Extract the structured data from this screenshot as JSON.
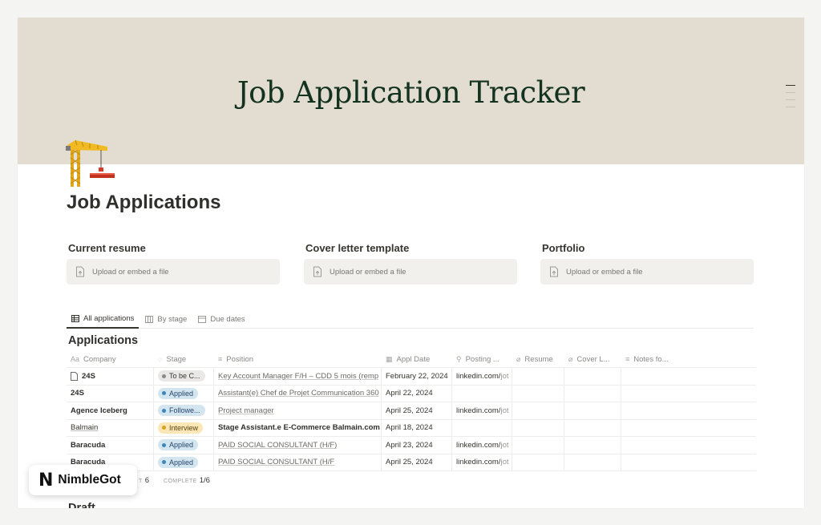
{
  "cover": {
    "title": "Job Application Tracker"
  },
  "page": {
    "title": "Job Applications"
  },
  "files": [
    {
      "label": "Current resume",
      "placeholder": "Upload or embed a file"
    },
    {
      "label": "Cover letter template",
      "placeholder": "Upload or embed a file"
    },
    {
      "label": "Portfolio",
      "placeholder": "Upload or embed a file"
    }
  ],
  "tabs": [
    "All applications",
    "By stage",
    "Due dates"
  ],
  "database": {
    "title": "Applications",
    "columns": [
      "Company",
      "Stage",
      "Position",
      "Appl Date",
      "Posting ...",
      "Resume",
      "Cover L...",
      "Notes fo..."
    ],
    "rows": [
      {
        "company": "24S",
        "stage": "To be C...",
        "position": "Key Account Manager F/H – CDD 5 mois (remp",
        "date": "February 22, 2024",
        "posting_a": "linkedin.com/",
        "posting_b": "jot"
      },
      {
        "company": "24S",
        "stage": "Applied",
        "position": "Assistant(e) Chef de Projet Communication 360",
        "date": "April 22, 2024",
        "posting_a": "",
        "posting_b": ""
      },
      {
        "company": "Agence Iceberg",
        "stage": "Followe...",
        "position": "Project manager",
        "date": "April 25, 2024",
        "posting_a": "linkedin.com/",
        "posting_b": "jot"
      },
      {
        "company": "Balmain",
        "stage": "Interview",
        "position": "Stage Assistant.e E-Commerce Balmain.com",
        "date": "April 18, 2024",
        "posting_a": "",
        "posting_b": ""
      },
      {
        "company": "Baracuda",
        "stage": "Applied",
        "position": "PAID SOCIAL CONSULTANT (H/F)",
        "date": "April 23, 2024",
        "posting_a": "linkedin.com/",
        "posting_b": "jot"
      },
      {
        "company": "Baracuda",
        "stage": "Applied",
        "position": "PAID SOCIAL CONSULTANT (H/F",
        "date": "April 25, 2024",
        "posting_a": "linkedin.com/",
        "posting_b": "jot"
      }
    ]
  },
  "footer": {
    "count_label": "T",
    "count_value": "6",
    "complete_label": "COMPLETE",
    "complete_value": "1/6"
  },
  "next_section": {
    "title": "Draft"
  },
  "brand": {
    "name": "NimbleGot",
    "mark": "N"
  },
  "stage_colors": {
    "To be C...": {
      "bg": "#e9e8e6",
      "dot": "#8a8985",
      "fg": "#37352f"
    },
    "Applied": {
      "bg": "#d3e5ef",
      "dot": "#3d86bd",
      "fg": "#28456c"
    },
    "Followe...": {
      "bg": "#d3e5ef",
      "dot": "#3d86bd",
      "fg": "#28456c"
    },
    "Interview": {
      "bg": "#fbe7b5",
      "dot": "#d6a023",
      "fg": "#5a4212"
    }
  }
}
